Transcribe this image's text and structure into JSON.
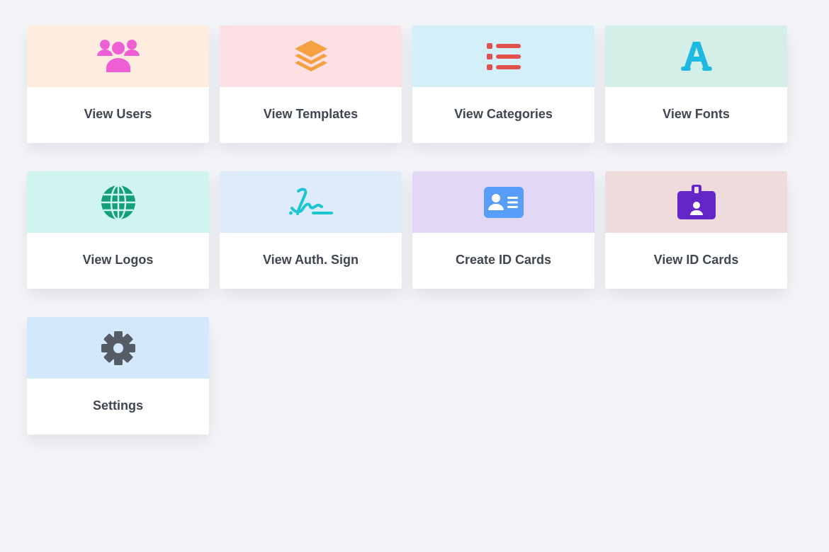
{
  "cards": [
    {
      "label": "View Users",
      "icon": "users-icon",
      "bg": "#feecdf",
      "color": "#ee5fd6"
    },
    {
      "label": "View Templates",
      "icon": "layers-icon",
      "bg": "#fde0e3",
      "color": "#f5a142"
    },
    {
      "label": "View Categories",
      "icon": "list-icon",
      "bg": "#d3f0f8",
      "color": "#e0504d"
    },
    {
      "label": "View Fonts",
      "icon": "font-icon",
      "bg": "#d3efe8",
      "color": "#1db9e0"
    },
    {
      "label": "View Logos",
      "icon": "globe-icon",
      "bg": "#d0f5f0",
      "color": "#149e7c"
    },
    {
      "label": "View Auth. Sign",
      "icon": "signature-icon",
      "bg": "#ddebfb",
      "color": "#1cc5d3"
    },
    {
      "label": "Create ID Cards",
      "icon": "id-card-icon",
      "bg": "#e2d7f5",
      "color": "#589ef8"
    },
    {
      "label": "View ID Cards",
      "icon": "id-badge-icon",
      "bg": "#f0dbdc",
      "color": "#6426c9"
    },
    {
      "label": "Settings",
      "icon": "gear-icon",
      "bg": "#d4e8fb",
      "color": "#555c66"
    }
  ]
}
